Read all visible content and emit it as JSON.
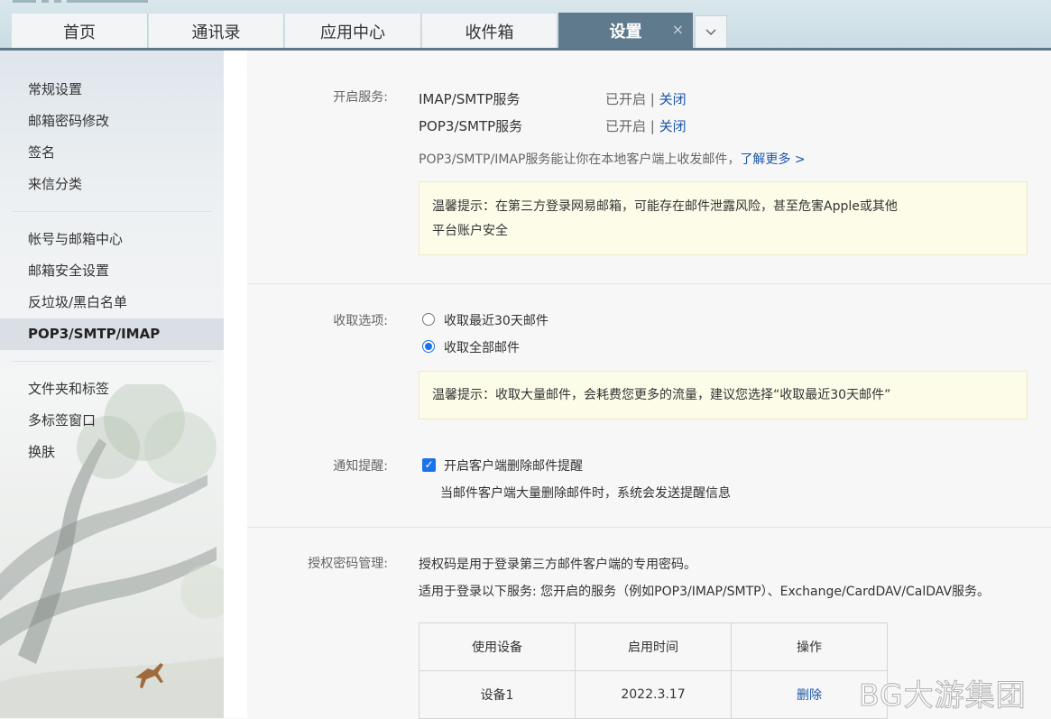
{
  "tabs": [
    {
      "label": "首页"
    },
    {
      "label": "通讯录"
    },
    {
      "label": "应用中心"
    },
    {
      "label": "收件箱"
    },
    {
      "label": "设置",
      "active": true
    }
  ],
  "tab_close": "×",
  "tab_more": "⌄",
  "sidebar": {
    "items": [
      {
        "label": "常规设置"
      },
      {
        "label": "邮箱密码修改"
      },
      {
        "label": "签名"
      },
      {
        "label": "来信分类"
      },
      {
        "label": "帐号与邮箱中心"
      },
      {
        "label": "邮箱安全设置"
      },
      {
        "label": "反垃圾/黑白名单"
      },
      {
        "label": "POP3/SMTP/IMAP",
        "active": true
      },
      {
        "label": "文件夹和标签"
      },
      {
        "label": "多标签窗口"
      },
      {
        "label": "换肤"
      }
    ]
  },
  "services": {
    "label": "开启服务:",
    "rows": [
      {
        "name": "IMAP/SMTP服务",
        "status": "已开启",
        "sep": "|",
        "action": "关闭"
      },
      {
        "name": "POP3/SMTP服务",
        "status": "已开启",
        "sep": "|",
        "action": "关闭"
      }
    ],
    "desc": "POP3/SMTP/IMAP服务能让你在本地客户端上收发邮件，",
    "learn_more": "了解更多 >",
    "notice_line1": "温馨提示：在第三方登录网易邮箱，可能存在邮件泄露风险，甚至危害Apple或其他",
    "notice_line2": "平台账户安全"
  },
  "fetch": {
    "label": "收取选项:",
    "options": [
      {
        "label": "收取最近30天邮件",
        "checked": false
      },
      {
        "label": "收取全部邮件",
        "checked": true
      }
    ],
    "notice": "温馨提示：收取大量邮件，会耗费您更多的流量，建议您选择“收取最近30天邮件”"
  },
  "notify": {
    "label": "通知提醒:",
    "checkbox_label": "开启客户端删除邮件提醒",
    "checked": true,
    "hint": "当邮件客户端大量删除邮件时，系统会发送提醒信息"
  },
  "auth": {
    "label": "授权密码管理:",
    "line1": "授权码是用于登录第三方邮件客户端的专用密码。",
    "line2": "适用于登录以下服务: 您开启的服务（例如POP3/IMAP/SMTP）、Exchange/CardDAV/CalDAV服务。",
    "table": {
      "headers": [
        "使用设备",
        "启用时间",
        "操作"
      ],
      "rows": [
        {
          "device": "设备1",
          "time": "2022.3.17",
          "action": "删除"
        }
      ]
    }
  },
  "watermark": "BG大游集团",
  "colors": {
    "accent": "#1a73e8",
    "link": "#1a56a8",
    "active_tab": "#5f7a8c"
  }
}
